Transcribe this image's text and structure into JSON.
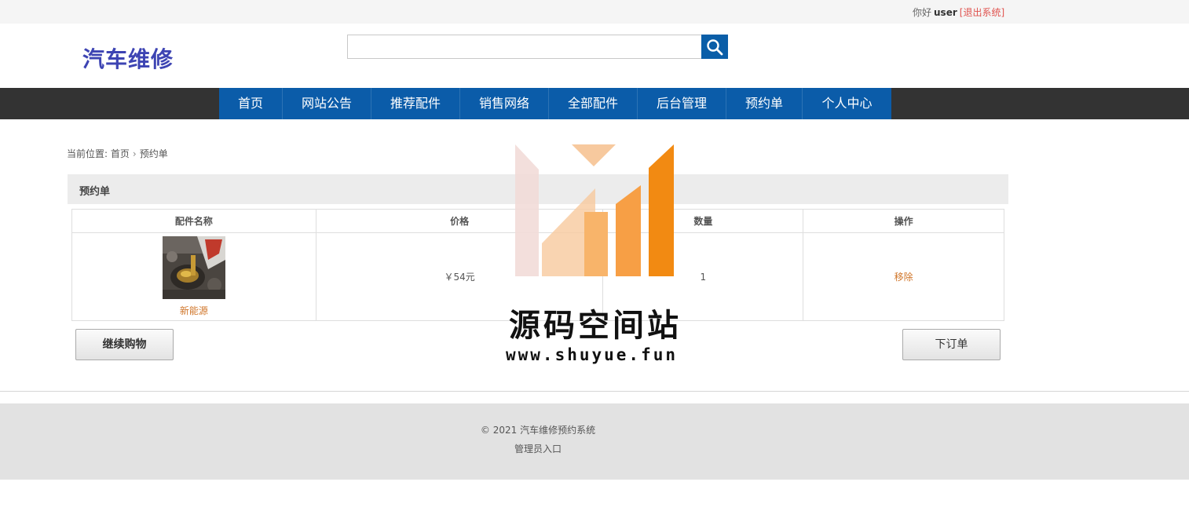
{
  "topbar": {
    "greeting": "你好",
    "username": "user",
    "logout": "[退出系统]"
  },
  "header": {
    "logo": "汽车维修",
    "search": {
      "value": "",
      "placeholder": ""
    }
  },
  "nav": {
    "items": [
      "首页",
      "网站公告",
      "推荐配件",
      "销售网络",
      "全部配件",
      "后台管理",
      "预约单",
      "个人中心"
    ]
  },
  "breadcrumb": {
    "prefix": "当前位置:",
    "home": "首页",
    "separator": "›",
    "current": "预约单"
  },
  "panel": {
    "title": "预约单"
  },
  "table": {
    "headers": [
      "配件名称",
      "价格",
      "数量",
      "操作"
    ],
    "rows": [
      {
        "name": "新能源",
        "price": "￥54元",
        "quantity": "1",
        "action": "移除"
      }
    ]
  },
  "buttons": {
    "continue": "继续购物",
    "order": "下订单"
  },
  "footer": {
    "copyright": "© 2021 汽车维修预约系统",
    "admin": "管理员入口"
  },
  "watermark": {
    "title": "源码空间站",
    "url": "www.shuyue.fun"
  },
  "colors": {
    "nav_bg": "#0b5ca9",
    "logo": "#3d44b3",
    "accent_orange": "#d0762a",
    "logout_red": "#e0534f"
  }
}
